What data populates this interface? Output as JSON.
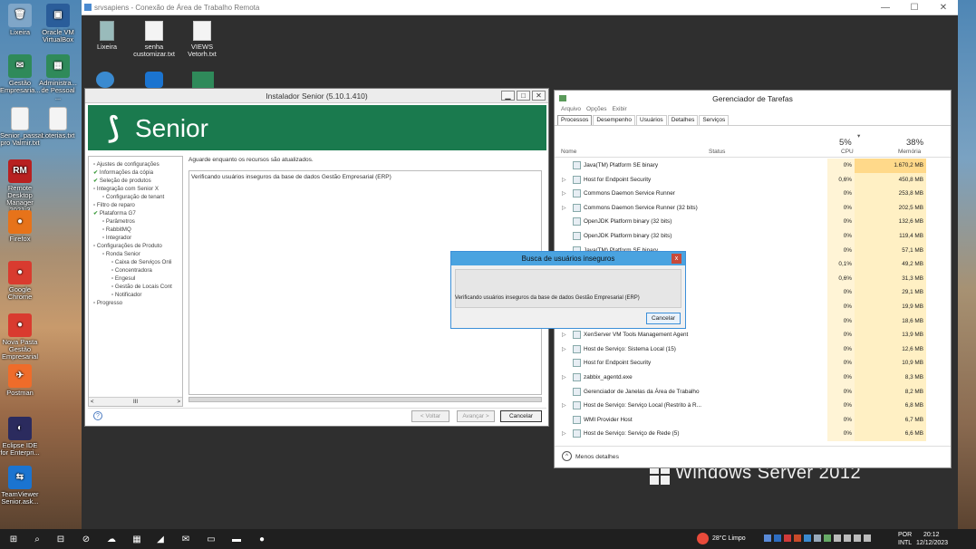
{
  "local_desktop": {
    "left_icons": [
      {
        "label": "Lixeira",
        "color": "#7fa6c8",
        "glyph": "🗑"
      },
      {
        "label": "Oracle VM VirtualBox",
        "color": "#2a5d9a",
        "glyph": "▣"
      },
      {
        "label": "Gestão Empresaria...",
        "color": "#2f8a5a",
        "glyph": "✉"
      },
      {
        "label": "Administra... de Pessoal ...",
        "color": "#2f8a5a",
        "glyph": "▦"
      },
      {
        "label": "Senior_passar pro Valmir.txt",
        "color": "#f4f4f4",
        "glyph": ""
      },
      {
        "label": "Loterias.txt",
        "color": "#f4f4f4",
        "glyph": ""
      },
      {
        "label": "Remote Desktop Manager 2021.3",
        "color": "#b82020",
        "glyph": "RM"
      },
      {
        "label": "Firefox",
        "color": "#e7731a",
        "glyph": "●"
      },
      {
        "label": "Google Chrome",
        "color": "#d93b2f",
        "glyph": "●"
      },
      {
        "label": "Nova Pasta Gestão Empresarial",
        "color": "#d93b2f",
        "glyph": "●"
      },
      {
        "label": "Postman",
        "color": "#ef6c2a",
        "glyph": "✈"
      },
      {
        "label": "Eclipse IDE for Enterpri...",
        "color": "#2b2b5e",
        "glyph": "◐"
      },
      {
        "label": "TeamViewer Senior.ask...",
        "color": "#1b74d0",
        "glyph": "⇆"
      }
    ]
  },
  "rdp_window": {
    "title": "srvsapiens - Conexão de Área de Trabalho Remota",
    "min_glyph": "—",
    "max_glyph": "☐",
    "close_glyph": "✕",
    "desktop_icons": [
      {
        "label": "Lixeira"
      },
      {
        "label": "senha customizar.txt"
      },
      {
        "label": "VIEWS Vetorh.txt"
      }
    ],
    "watermark": "Windows Server 2012"
  },
  "installer": {
    "title": "Instalador Senior (5.10.1.410)",
    "logo_text": "Senior",
    "tree": [
      {
        "label": "Ajustes de configurações",
        "indent": 0,
        "checked": false
      },
      {
        "label": "Informações da cópia",
        "indent": 0,
        "checked": true
      },
      {
        "label": "Seleção de produtos",
        "indent": 0,
        "checked": true
      },
      {
        "label": "Integração com Senior X",
        "indent": 0,
        "checked": false
      },
      {
        "label": "Configuração de tenant",
        "indent": 1,
        "checked": false
      },
      {
        "label": "Filtro de reparo",
        "indent": 0,
        "checked": false
      },
      {
        "label": "Plataforma G7",
        "indent": 0,
        "checked": true
      },
      {
        "label": "Parâmetros",
        "indent": 1,
        "checked": false
      },
      {
        "label": "RabbitMQ",
        "indent": 1,
        "checked": false
      },
      {
        "label": "Integrador",
        "indent": 1,
        "checked": false
      },
      {
        "label": "Configurações de Produto",
        "indent": 0,
        "checked": false
      },
      {
        "label": "Ronda Senior",
        "indent": 1,
        "checked": false
      },
      {
        "label": "Caixa de Serviços Onli",
        "indent": 2,
        "checked": false
      },
      {
        "label": "Concentradora",
        "indent": 2,
        "checked": false
      },
      {
        "label": "Engesul",
        "indent": 2,
        "checked": false
      },
      {
        "label": "Gestão de Locais Cont",
        "indent": 2,
        "checked": false
      },
      {
        "label": "Notificador",
        "indent": 2,
        "checked": false
      },
      {
        "label": "Progresso",
        "indent": 0,
        "checked": false
      }
    ],
    "status": "Aguarde enquanto os recursos são atualizados.",
    "log_line": "Verificando usuários inseguros da base de dados Gestão Empresarial (ERP)",
    "scroll_left": "<",
    "scroll_mid": "III",
    "scroll_right": ">",
    "help_glyph": "?",
    "back_label": "< Voltar",
    "next_label": "Avançar >",
    "cancel_label": "Cancelar"
  },
  "dialog": {
    "title": "Busca de usuários inseguros",
    "close_glyph": "x",
    "message": "Verificando usuários inseguros da base de dados Gestão Empresarial (ERP)",
    "cancel_label": "Cancelar"
  },
  "task_manager": {
    "title": "Gerenciador de Tarefas",
    "menu": [
      "Arquivo",
      "Opções",
      "Exibir"
    ],
    "tabs": [
      "Processos",
      "Desempenho",
      "Usuários",
      "Detalhes",
      "Serviços"
    ],
    "col_name": "Nome",
    "col_status": "Status",
    "col_cpu": "CPU",
    "col_mem": "Memória",
    "cpu_total": "5%",
    "mem_total": "38%",
    "sort_glyph": "▾",
    "processes": [
      {
        "name": "Java(TM) Platform SE binary",
        "expand": "",
        "cpu": "0%",
        "mem": "1.670,2 MB"
      },
      {
        "name": "Host for Endpoint Security",
        "expand": "▷",
        "cpu": "0,6%",
        "mem": "450,8 MB"
      },
      {
        "name": "Commons Daemon Service Runner",
        "expand": "▷",
        "cpu": "0%",
        "mem": "253,8 MB"
      },
      {
        "name": "Commons Daemon Service Runner (32 bits)",
        "expand": "▷",
        "cpu": "0%",
        "mem": "202,5 MB"
      },
      {
        "name": "OpenJDK Platform binary (32 bits)",
        "expand": "",
        "cpu": "0%",
        "mem": "132,6 MB"
      },
      {
        "name": "OpenJDK Platform binary (32 bits)",
        "expand": "",
        "cpu": "0%",
        "mem": "119,4 MB"
      },
      {
        "name": "Java(TM) Platform SE binary",
        "expand": "",
        "cpu": "0%",
        "mem": "57,1 MB"
      },
      {
        "name": "",
        "expand": "",
        "cpu": "0,1%",
        "mem": "49,2 MB"
      },
      {
        "name": "",
        "expand": "",
        "cpu": "0,6%",
        "mem": "31,3 MB"
      },
      {
        "name": "...unner...",
        "expand": "",
        "cpu": "0%",
        "mem": "29,1 MB"
      },
      {
        "name": "",
        "expand": "",
        "cpu": "0%",
        "mem": "19,9 MB"
      },
      {
        "name": "",
        "expand": "",
        "cpu": "0%",
        "mem": "18,6 MB"
      },
      {
        "name": "XenServer VM Tools Management Agent",
        "expand": "▷",
        "cpu": "0%",
        "mem": "13,9 MB"
      },
      {
        "name": "Host de Serviço: Sistema Local (15)",
        "expand": "▷",
        "cpu": "0%",
        "mem": "12,6 MB"
      },
      {
        "name": "Host for Endpoint Security",
        "expand": "",
        "cpu": "0%",
        "mem": "10,9 MB"
      },
      {
        "name": "zabbix_agentd.exe",
        "expand": "▷",
        "cpu": "0%",
        "mem": "8,3 MB"
      },
      {
        "name": "Gerenciador de Janelas da Área de Trabalho",
        "expand": "",
        "cpu": "0%",
        "mem": "8,2 MB"
      },
      {
        "name": "Host de Serviço: Serviço Local (Restrito à R...",
        "expand": "▷",
        "cpu": "0%",
        "mem": "6,8 MB"
      },
      {
        "name": "WMI Provider Host",
        "expand": "",
        "cpu": "0%",
        "mem": "6,7 MB"
      },
      {
        "name": "Host de Serviço: Serviço de Rede (5)",
        "expand": "▷",
        "cpu": "0%",
        "mem": "6,6 MB"
      }
    ],
    "fewer_details": "Menos detalhes",
    "fewer_glyph": "^"
  },
  "taskbar": {
    "weather": "28°C Limpo",
    "lang": "POR",
    "layout": "INTL",
    "time": "20:12",
    "date": "12/12/2023",
    "apps": [
      "⊞",
      "⌕",
      "⊟",
      "⊘",
      "☁",
      "▦",
      "◢",
      "✉",
      "▭",
      "▬",
      "●"
    ]
  }
}
